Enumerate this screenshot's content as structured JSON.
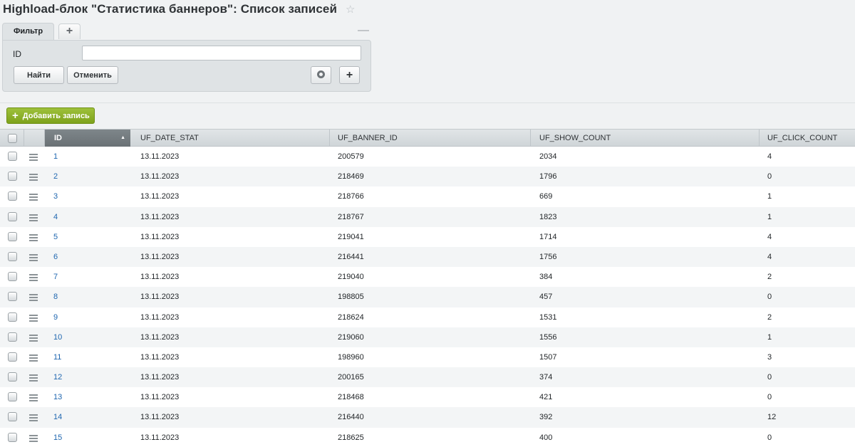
{
  "title": "Highload-блок \"Статистика баннеров\": Список записей",
  "filter": {
    "tab_label": "Фильтр",
    "add_tab_label": "+",
    "collapse_label": "—",
    "field_label": "ID",
    "field_value": "",
    "find_label": "Найти",
    "cancel_label": "Отменить",
    "add_field_label": "+"
  },
  "toolbar": {
    "add_record_label": "Добавить запись",
    "add_icon": "+"
  },
  "table": {
    "columns": [
      "ID",
      "UF_DATE_STAT",
      "UF_BANNER_ID",
      "UF_SHOW_COUNT",
      "UF_CLICK_COUNT"
    ],
    "sort_arrow": "▲",
    "rows": [
      [
        "1",
        "13.11.2023",
        "200579",
        "2034",
        "4"
      ],
      [
        "2",
        "13.11.2023",
        "218469",
        "1796",
        "0"
      ],
      [
        "3",
        "13.11.2023",
        "218766",
        "669",
        "1"
      ],
      [
        "4",
        "13.11.2023",
        "218767",
        "1823",
        "1"
      ],
      [
        "5",
        "13.11.2023",
        "219041",
        "1714",
        "4"
      ],
      [
        "6",
        "13.11.2023",
        "216441",
        "1756",
        "4"
      ],
      [
        "7",
        "13.11.2023",
        "219040",
        "384",
        "2"
      ],
      [
        "8",
        "13.11.2023",
        "198805",
        "457",
        "0"
      ],
      [
        "9",
        "13.11.2023",
        "218624",
        "1531",
        "2"
      ],
      [
        "10",
        "13.11.2023",
        "219060",
        "1556",
        "1"
      ],
      [
        "11",
        "13.11.2023",
        "198960",
        "1507",
        "3"
      ],
      [
        "12",
        "13.11.2023",
        "200165",
        "374",
        "0"
      ],
      [
        "13",
        "13.11.2023",
        "218468",
        "421",
        "0"
      ],
      [
        "14",
        "13.11.2023",
        "216440",
        "392",
        "12"
      ],
      [
        "15",
        "13.11.2023",
        "218625",
        "400",
        "0"
      ]
    ]
  }
}
